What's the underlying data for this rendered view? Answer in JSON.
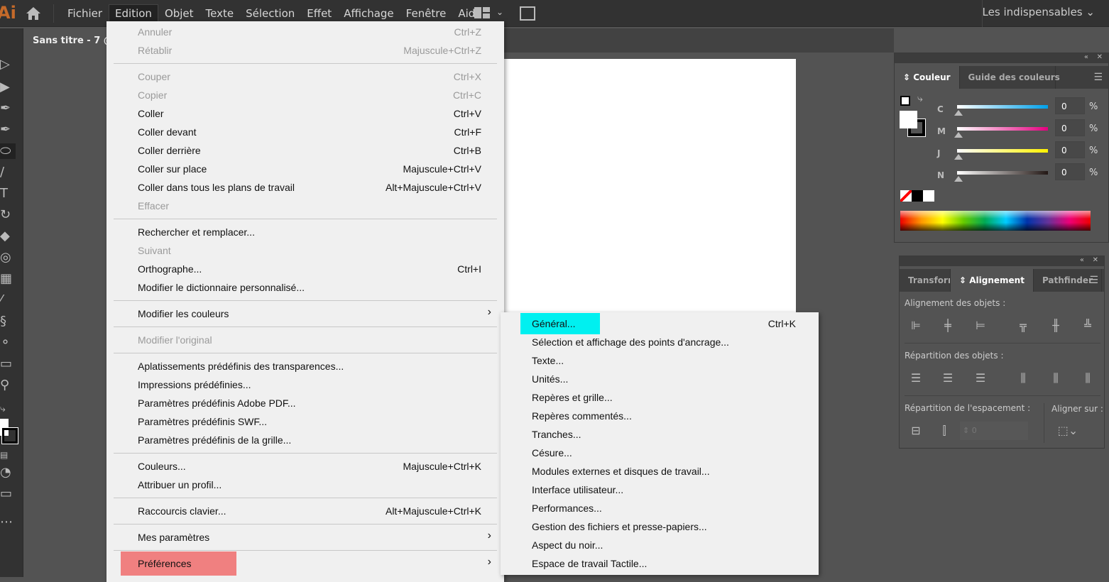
{
  "app": {
    "logo": "Ai",
    "document_tab": "Sans titre - 7 @",
    "workspace": "Les indispensables"
  },
  "menubar": [
    "Fichier",
    "Edition",
    "Objet",
    "Texte",
    "Sélection",
    "Effet",
    "Affichage",
    "Fenêtre",
    "Aide"
  ],
  "active_menu": "Edition",
  "edition_menu": [
    {
      "label": "Annuler",
      "shortcut": "Ctrl+Z",
      "disabled": true
    },
    {
      "label": "Rétablir",
      "shortcut": "Majuscule+Ctrl+Z",
      "disabled": true
    },
    {
      "separator": true
    },
    {
      "label": "Couper",
      "shortcut": "Ctrl+X",
      "disabled": true
    },
    {
      "label": "Copier",
      "shortcut": "Ctrl+C",
      "disabled": true
    },
    {
      "label": "Coller",
      "shortcut": "Ctrl+V"
    },
    {
      "label": "Coller devant",
      "shortcut": "Ctrl+F"
    },
    {
      "label": "Coller derrière",
      "shortcut": "Ctrl+B"
    },
    {
      "label": "Coller sur place",
      "shortcut": "Majuscule+Ctrl+V"
    },
    {
      "label": "Coller dans tous les plans de travail",
      "shortcut": "Alt+Majuscule+Ctrl+V"
    },
    {
      "label": "Effacer",
      "disabled": true
    },
    {
      "separator": true
    },
    {
      "label": "Rechercher et remplacer..."
    },
    {
      "label": "Suivant",
      "disabled": true
    },
    {
      "label": "Orthographe...",
      "shortcut": "Ctrl+I"
    },
    {
      "label": "Modifier le dictionnaire personnalisé..."
    },
    {
      "separator": true
    },
    {
      "label": "Modifier les couleurs",
      "submenu": true
    },
    {
      "separator": true
    },
    {
      "label": "Modifier l'original",
      "disabled": true
    },
    {
      "separator": true
    },
    {
      "label": "Aplatissements prédéfinis des transparences..."
    },
    {
      "label": "Impressions prédéfinies..."
    },
    {
      "label": "Paramètres prédéfinis Adobe PDF..."
    },
    {
      "label": "Paramètres prédéfinis SWF..."
    },
    {
      "label": "Paramètres prédéfinis de la grille..."
    },
    {
      "separator": true
    },
    {
      "label": "Couleurs...",
      "shortcut": "Majuscule+Ctrl+K"
    },
    {
      "label": "Attribuer un profil..."
    },
    {
      "separator": true
    },
    {
      "label": "Raccourcis clavier...",
      "shortcut": "Alt+Majuscule+Ctrl+K"
    },
    {
      "separator": true
    },
    {
      "label": "Mes paramètres",
      "submenu": true
    },
    {
      "separator": true
    },
    {
      "label": "Préférences",
      "submenu": true,
      "highlighted": true
    }
  ],
  "preferences_submenu": [
    {
      "label": "Général...",
      "shortcut": "Ctrl+K",
      "highlighted": true
    },
    {
      "label": "Sélection et affichage des points d'ancrage..."
    },
    {
      "label": "Texte..."
    },
    {
      "label": "Unités..."
    },
    {
      "label": "Repères et grille..."
    },
    {
      "label": "Repères commentés..."
    },
    {
      "label": "Tranches..."
    },
    {
      "label": "Césure..."
    },
    {
      "label": "Modules externes et disques de travail..."
    },
    {
      "label": "Interface utilisateur..."
    },
    {
      "label": "Performances..."
    },
    {
      "label": "Gestion des fichiers et presse-papiers..."
    },
    {
      "label": "Aspect du noir..."
    },
    {
      "label": "Espace de travail Tactile..."
    }
  ],
  "color_panel": {
    "tabs": [
      "Couleur",
      "Guide des couleurs"
    ],
    "active_tab": "Couleur",
    "sliders": [
      {
        "label": "C",
        "value": "0",
        "unit": "%",
        "color": "#00a0e9"
      },
      {
        "label": "M",
        "value": "0",
        "unit": "%",
        "color": "#e4007f"
      },
      {
        "label": "J",
        "value": "0",
        "unit": "%",
        "color": "#fff100"
      },
      {
        "label": "N",
        "value": "0",
        "unit": "%",
        "color": "#231815"
      }
    ]
  },
  "align_panel": {
    "tabs": [
      "Transform",
      "Alignement",
      "Pathfinder"
    ],
    "active_tab": "Alignement",
    "section_align": "Alignement des objets :",
    "section_distribute": "Répartition des objets :",
    "section_spacing": "Répartition de l'espacement :",
    "align_to": "Aligner sur :",
    "spacing_value": "0"
  },
  "colors": {
    "highlight_general": "#00f0f0",
    "highlight_preferences": "#f08080"
  }
}
